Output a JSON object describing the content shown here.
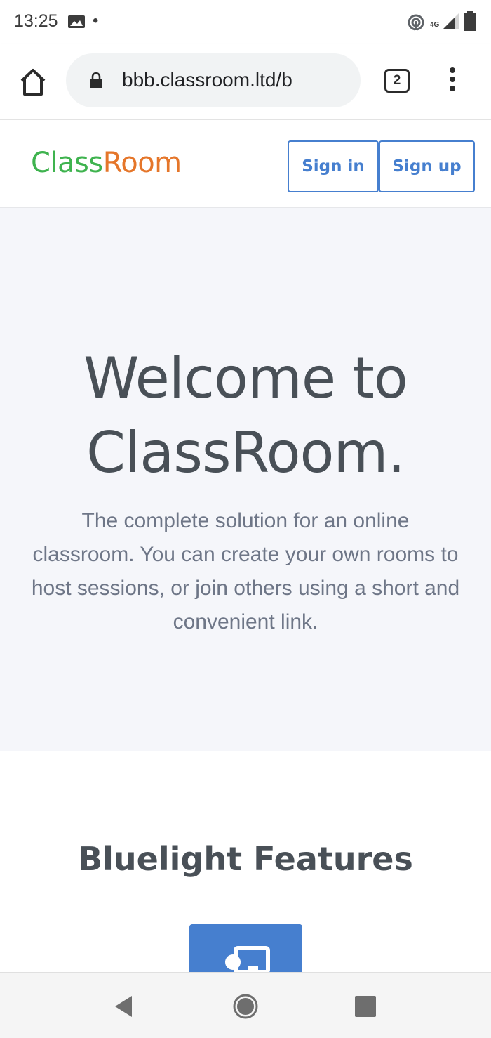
{
  "status_bar": {
    "time": "13:25",
    "dot": "•",
    "network_label": "4G",
    "icons": [
      "gallery-icon",
      "hotspot-icon",
      "signal-icon",
      "battery-icon"
    ]
  },
  "browser": {
    "url": "bbb.classroom.ltd/b",
    "tab_count": "2",
    "icons": [
      "home-icon",
      "lock-icon",
      "tabs-icon",
      "overflow-menu-icon"
    ]
  },
  "header": {
    "logo_part1": "Class",
    "logo_part2": "Room",
    "sign_in_label": "Sign in",
    "sign_up_label": "Sign up"
  },
  "hero": {
    "title_line1": "Welcome to",
    "title_line2": "ClassRoom.",
    "description": "The complete solution for an online classroom. You can create your own rooms to host sessions, or join others using a short and convenient link."
  },
  "features": {
    "title": "Bluelight Features"
  },
  "colors": {
    "logo_green": "#3fb34f",
    "logo_orange": "#e5762a",
    "primary_blue": "#467fcf",
    "hero_bg": "#f5f6fa",
    "text_dark": "#495057",
    "text_muted": "#6e7687"
  }
}
